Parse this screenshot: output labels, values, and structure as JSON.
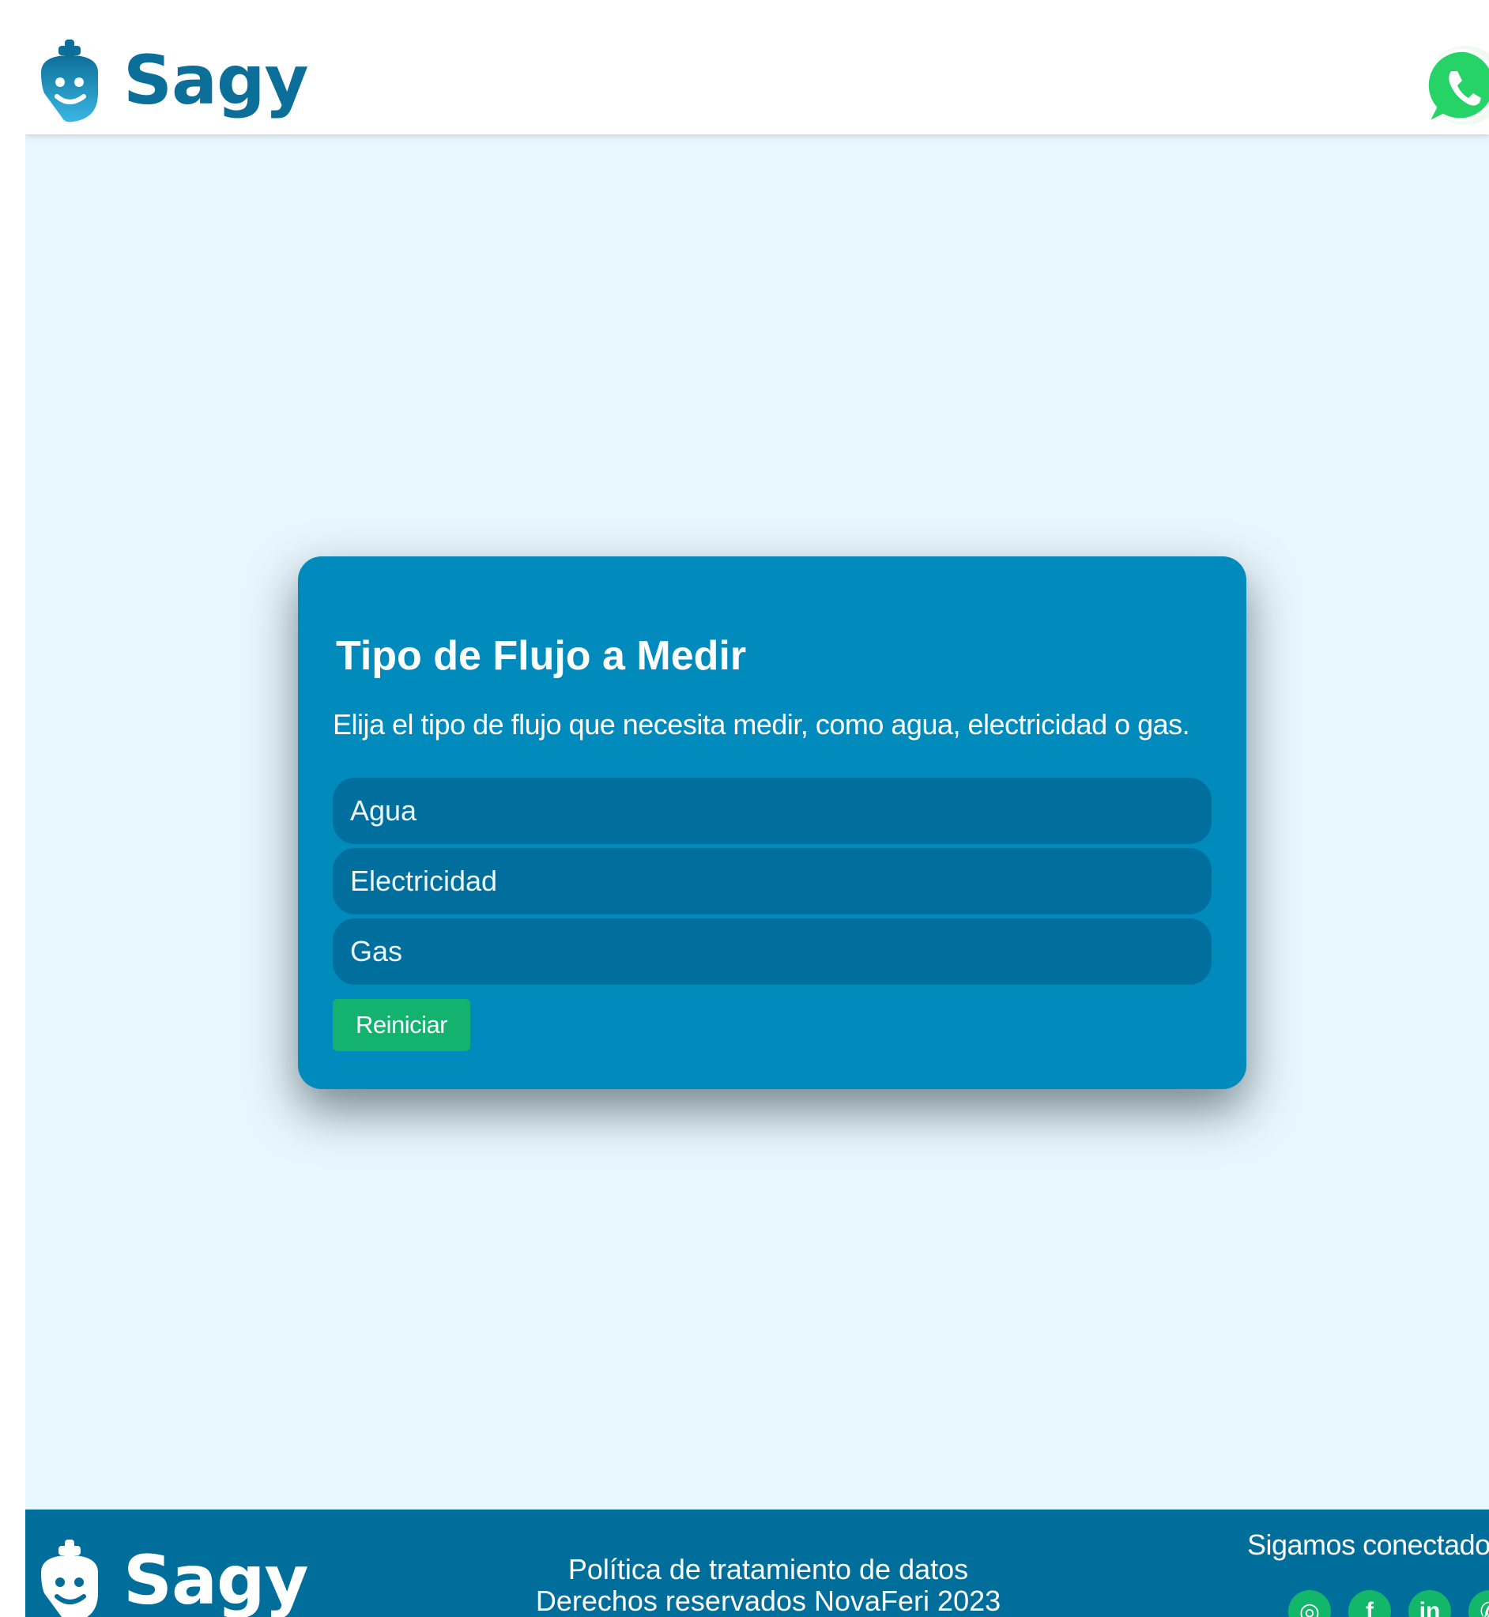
{
  "header": {
    "brand": "Sagy",
    "logo_icon": "sagy-logo-icon",
    "whatsapp_icon": "whatsapp-icon"
  },
  "card": {
    "title": "Tipo de Flujo a Medir",
    "description": "Elija el tipo de flujo que necesita medir, como agua, electricidad o gas.",
    "options": [
      {
        "label": "Agua"
      },
      {
        "label": "Electricidad"
      },
      {
        "label": "Gas"
      }
    ],
    "reset_label": "Reiniciar"
  },
  "footer": {
    "brand": "Sagy",
    "policy_link": "Política de tratamiento de datos",
    "rights": "Derechos reservados NovaFeri 2023",
    "social_title": "Sigamos conectados",
    "social": [
      {
        "icon": "instagram-icon",
        "glyph": "◎"
      },
      {
        "icon": "facebook-icon",
        "glyph": "f"
      },
      {
        "icon": "linkedin-icon",
        "glyph": "in"
      },
      {
        "icon": "whatsapp-icon",
        "glyph": "✆"
      }
    ]
  },
  "colors": {
    "brand_blue": "#0c6f99",
    "card_blue": "#008bbc",
    "option_blue": "#006f9e",
    "reset_green": "#13b36f",
    "page_background": "#e8f6fd",
    "whatsapp_green": "#25d366"
  }
}
